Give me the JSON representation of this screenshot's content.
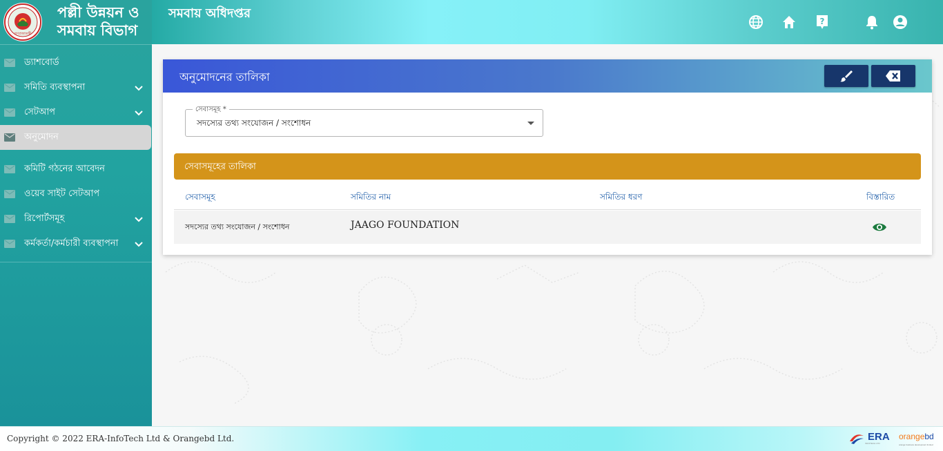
{
  "brand": {
    "line1": "পল্লী উন্নয়ন ও",
    "line2": "সমবায় বিভাগ"
  },
  "topbar": {
    "title": "সমবায় অধিদপ্তর",
    "icons": [
      "globe-icon",
      "home-icon",
      "help-icon",
      "bell-icon",
      "account-icon"
    ]
  },
  "sidebar": {
    "items": [
      {
        "label": "ড্যাশবোর্ড",
        "has_submenu": false,
        "active": false
      },
      {
        "label": "সমিতি ব্যবস্থাপনা",
        "has_submenu": true,
        "active": false
      },
      {
        "label": "সেটআপ",
        "has_submenu": true,
        "active": false
      },
      {
        "label": "অনুমোদন",
        "has_submenu": false,
        "active": true
      },
      {
        "label": "কমিটি গঠনের আবেদন",
        "has_submenu": false,
        "active": false
      },
      {
        "label": "ওয়েব সাইট সেটআপ",
        "has_submenu": false,
        "active": false
      },
      {
        "label": "রিপোর্টসমূহ",
        "has_submenu": true,
        "active": false
      },
      {
        "label": "কর্মকর্তা/কর্মচারী ব্যবস্থাপনা",
        "has_submenu": true,
        "active": false
      }
    ]
  },
  "card": {
    "title": "অনুমোদনের তালিকা",
    "buttons": [
      "brush-icon",
      "backspace-icon"
    ]
  },
  "service_select": {
    "label": "সেবাসমূহ *",
    "value": "সদস্যের তথ্য সংযোজন / সংশোধন"
  },
  "table": {
    "banner": "সেবাসমূহের তালিকা",
    "headers": [
      "সেবাসমূহ",
      "সমিতির নাম",
      "সমিতির ধরণ",
      "বিস্তারিত"
    ],
    "rows": [
      {
        "service": "সদস্যের তথ্য সংযোজন / সংশোধন",
        "samity_name": "JAAGO FOUNDATION",
        "samity_type": "",
        "details_icon": "eye-icon"
      }
    ]
  },
  "footer": {
    "copyright": "Copyright © 2022 ERA-InfoTech Ltd & Orangebd Ltd.",
    "era_logo": "ERA",
    "era_sub": "INFOTECH LTD",
    "orangebd_orange": "orange",
    "orangebd_blue": "bd",
    "orangebd_sub": "orange business development limited"
  },
  "colors": {
    "sidebar": "#22a3a0",
    "active_item": "#d6d6d6",
    "header_btn": "#17366b",
    "banner": "#d4941a",
    "table_header_text": "#1e5da8",
    "eye": "#1b7a3e"
  }
}
